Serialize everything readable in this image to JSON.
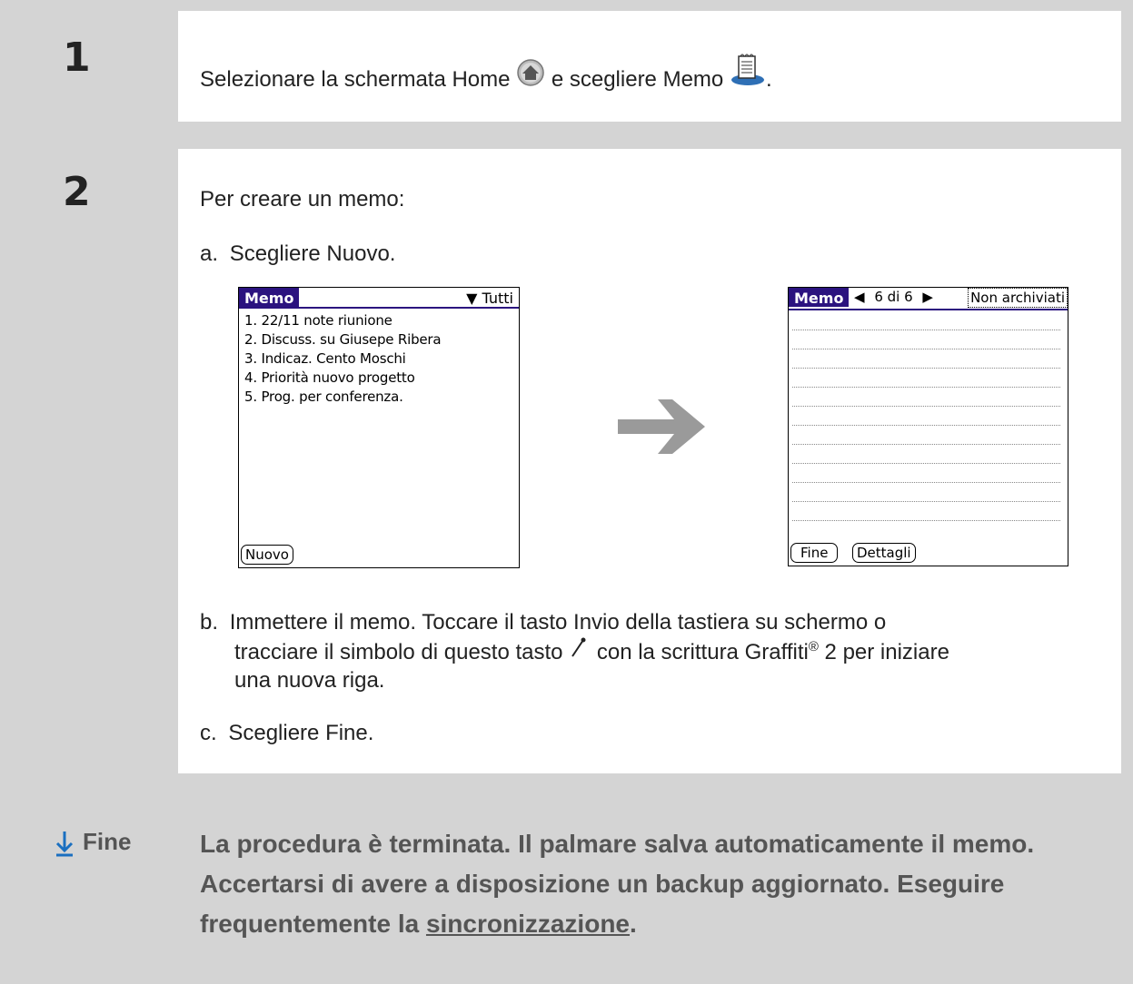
{
  "step1": {
    "number": "1",
    "text_before": "Selezionare la schermata Home",
    "text_middle": "e scegliere Memo",
    "text_after": ".",
    "icons": [
      "home-icon",
      "memo-app-icon"
    ]
  },
  "step2": {
    "number": "2",
    "intro": "Per creare un memo:",
    "a": {
      "letter": "a.",
      "text": "Scegliere Nuovo."
    },
    "b": {
      "letter": "b.",
      "line1": "Immettere il memo. Toccare il tasto Invio della tastiera su schermo o",
      "line2_before": "tracciare il simbolo di questo tasto",
      "line2_after": "con la scrittura Graffiti",
      "reg": "®",
      "line2_end": "2 per iniziare",
      "line3": "una nuova riga."
    },
    "c": {
      "letter": "c.",
      "text": "Scegliere Fine."
    }
  },
  "screen_list": {
    "title": "Memo",
    "category": "Tutti",
    "items": [
      "1. 22/11 note riunione",
      "2. Discuss. su Giusepe Ribera",
      "3. Indicaz. Cento Moschi",
      "4. Priorità nuovo progetto",
      "5. Prog. per conferenza."
    ],
    "button": "Nuovo"
  },
  "screen_edit": {
    "title": "Memo",
    "counter": "6 di 6",
    "category": "Non archiviati",
    "buttons": [
      "Fine",
      "Dettagli"
    ]
  },
  "footer": {
    "label": "Fine",
    "text_before": "La procedura è terminata. Il palmare salva automaticamente il memo. Accertarsi di avere a disposizione un backup aggiornato. Eseguire frequentemente la ",
    "link": "sincronizzazione",
    "text_after": "."
  },
  "colors": {
    "band": "#d4d4d4",
    "palm_title": "#2b137f",
    "arrow": "#9a9a9a",
    "footer_text": "#555555"
  }
}
